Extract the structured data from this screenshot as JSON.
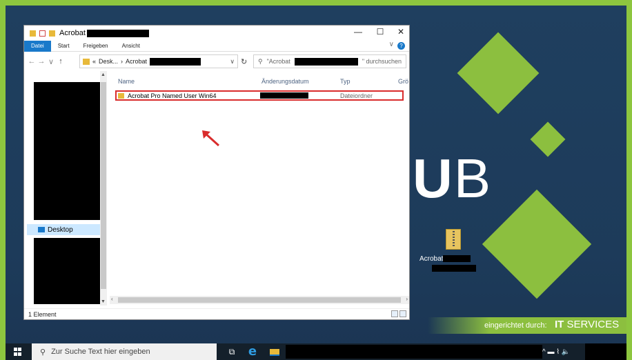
{
  "window": {
    "title": "Acrobat",
    "minimize": "—",
    "maximize": "☐",
    "close": "✕"
  },
  "ribbon": {
    "tabs": [
      "Datei",
      "Start",
      "Freigeben",
      "Ansicht"
    ],
    "collapse": "∨",
    "help": "?"
  },
  "navbar": {
    "back": "←",
    "forward": "→",
    "recent": "∨",
    "up": "↑",
    "address_prefix": "«",
    "address_desk": "Desk...",
    "address_sep": "›",
    "address_folder": "Acrobat",
    "address_dropdown": "∨",
    "refresh": "↻",
    "search_prefix": "\"Acrobat",
    "search_suffix": "\" durchsuchen"
  },
  "nav_pane": {
    "desktop_label": "Desktop"
  },
  "columns": {
    "name": "Name",
    "date": "Änderungsdatum",
    "type": "Typ",
    "size": "Grö"
  },
  "files": [
    {
      "name": "Acrobat Pro Named User Win64",
      "type": "Dateiordner"
    }
  ],
  "statusbar": {
    "count": "1 Element"
  },
  "desktop": {
    "logo_u": "U",
    "logo_b": "B",
    "icon_label": "Acrobat",
    "brand_prefix": "eingerichtet durch:",
    "brand_it": "IT",
    "brand_services": "SERVICES"
  },
  "taskbar": {
    "search_placeholder": "Zur Suche Text hier eingeben",
    "tray": "^ ▬ ⌇ 🔈"
  },
  "colors": {
    "frame": "#8dc63f",
    "accent": "#1979ca",
    "highlight_border": "#d92c2c",
    "diamond": "#8cbf3f"
  }
}
